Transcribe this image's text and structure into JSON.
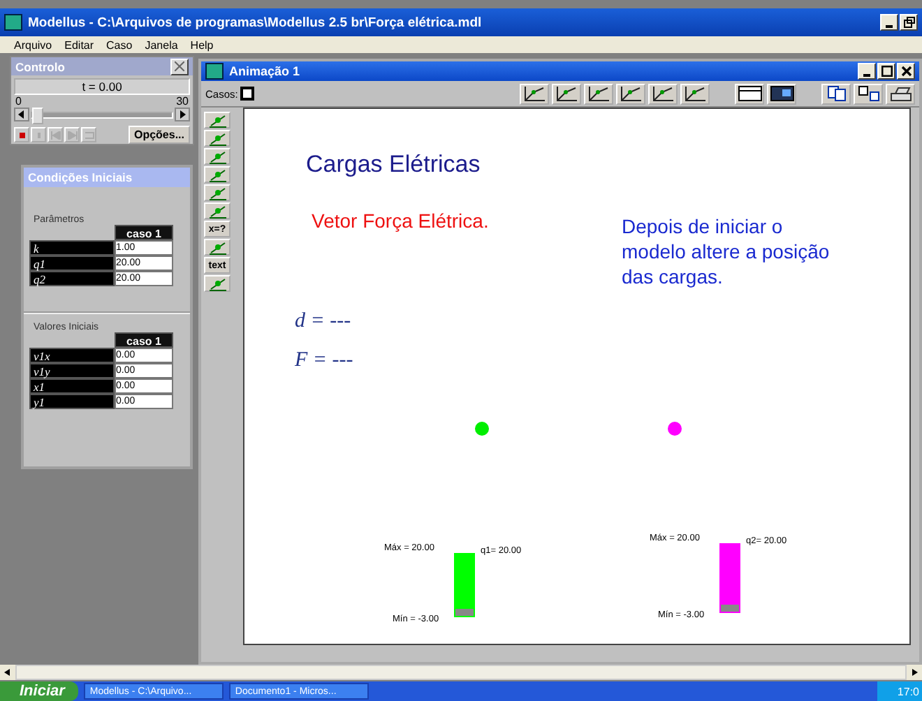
{
  "window": {
    "title": "Modellus - C:\\Arquivos de programas\\Modellus 2.5 br\\Força elétrica.mdl"
  },
  "menu": [
    "Arquivo",
    "Editar",
    "Caso",
    "Janela",
    "Help"
  ],
  "control": {
    "title": "Controlo",
    "time": "t =  0.00",
    "slider_min": "0",
    "slider_max": "30",
    "level": 0,
    "options": "Opções..."
  },
  "initial_conditions": {
    "title": "Condições Iniciais",
    "parameters": {
      "label": "Parâmetros",
      "column": "caso 1",
      "rows": [
        {
          "name": "k",
          "value": "1.00"
        },
        {
          "name": "q1",
          "value": "20.00"
        },
        {
          "name": "q2",
          "value": "20.00"
        }
      ]
    },
    "initial_values": {
      "label": "Valores Iniciais",
      "column": "caso 1",
      "rows": [
        {
          "name": "v1x",
          "value": "0.00"
        },
        {
          "name": "v1y",
          "value": "0.00"
        },
        {
          "name": "x1",
          "value": "0.00"
        },
        {
          "name": "y1",
          "value": "0.00"
        }
      ]
    }
  },
  "animation": {
    "title": "Animação 1",
    "cases_label": "Casos:",
    "tools": [
      {
        "kind": "icon"
      },
      {
        "kind": "icon"
      },
      {
        "kind": "icon"
      },
      {
        "kind": "icon"
      },
      {
        "kind": "icon"
      },
      {
        "kind": "icon"
      },
      {
        "kind": "text",
        "label": "x=?"
      },
      {
        "kind": "icon"
      },
      {
        "kind": "text",
        "label": "text"
      },
      {
        "kind": "icon"
      }
    ],
    "title_text": "Cargas Elétricas",
    "subtitle": "Vetor Força Elétrica.",
    "instruction": "Depois de iniciar o modelo altere a posição das cargas.",
    "d_label": "d = ---",
    "f_label": "F = ---",
    "charges": [
      {
        "color": "#00ee00"
      },
      {
        "color": "#ff00ff"
      }
    ],
    "bars": [
      {
        "max": "Máx = 20.00",
        "min": "Mín = -3.00",
        "reading": "q1= 20.00",
        "level": 1,
        "color": "#00ff00"
      },
      {
        "max": "Máx = 20.00",
        "min": "Mín = -3.00",
        "reading": "q2= 20.00",
        "level": 1,
        "color": "#ff00ff"
      }
    ]
  },
  "taskbar": {
    "start": "Iniciar",
    "tasks": [
      "Modellus - C:\\Arquivo...",
      "Documento1 - Micros..."
    ],
    "clock": "17:0"
  }
}
